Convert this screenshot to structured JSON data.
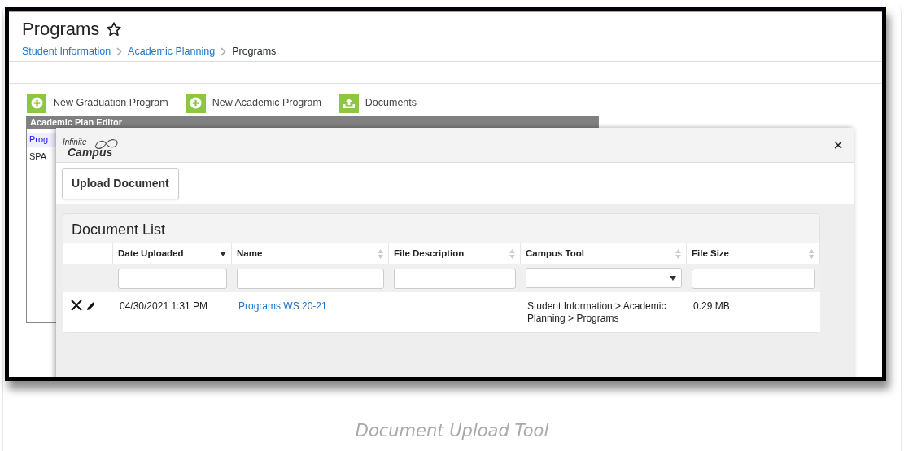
{
  "page": {
    "title": "Programs",
    "favorite": false,
    "breadcrumb": [
      {
        "label": "Student Information",
        "link": true
      },
      {
        "label": "Academic Planning",
        "link": true
      },
      {
        "label": "Programs",
        "link": false
      }
    ]
  },
  "toolbar": [
    {
      "label": "New Graduation Program",
      "kind": "add"
    },
    {
      "label": "New Academic Program",
      "kind": "add"
    },
    {
      "label": "Documents",
      "kind": "upload"
    }
  ],
  "editor": {
    "title": "Academic Plan Editor",
    "header": "Prog",
    "row": "SPA"
  },
  "modal": {
    "logo": [
      "Infinite",
      "Campus"
    ],
    "close": "×",
    "upload_button": "Upload Document",
    "list_title": "Document List",
    "columns": [
      {
        "label": "Date Uploaded",
        "sorted": true,
        "dropdown_filter": false
      },
      {
        "label": "Name",
        "sorted": false,
        "dropdown_filter": false
      },
      {
        "label": "File Description",
        "sorted": false,
        "dropdown_filter": false
      },
      {
        "label": "Campus Tool",
        "sorted": false,
        "dropdown_filter": true
      },
      {
        "label": "File Size",
        "sorted": false,
        "dropdown_filter": false
      }
    ],
    "rows": [
      {
        "cells": [
          {
            "text": "04/30/2021 1:31 PM",
            "link": false
          },
          {
            "text": "Programs WS 20-21",
            "link": true
          },
          {
            "text": ""
          },
          {
            "text": "Student Information > Academic Planning > Programs",
            "link": false
          },
          {
            "text": "0.29 MB",
            "link": false
          }
        ]
      }
    ]
  },
  "caption": "Document Upload Tool"
}
